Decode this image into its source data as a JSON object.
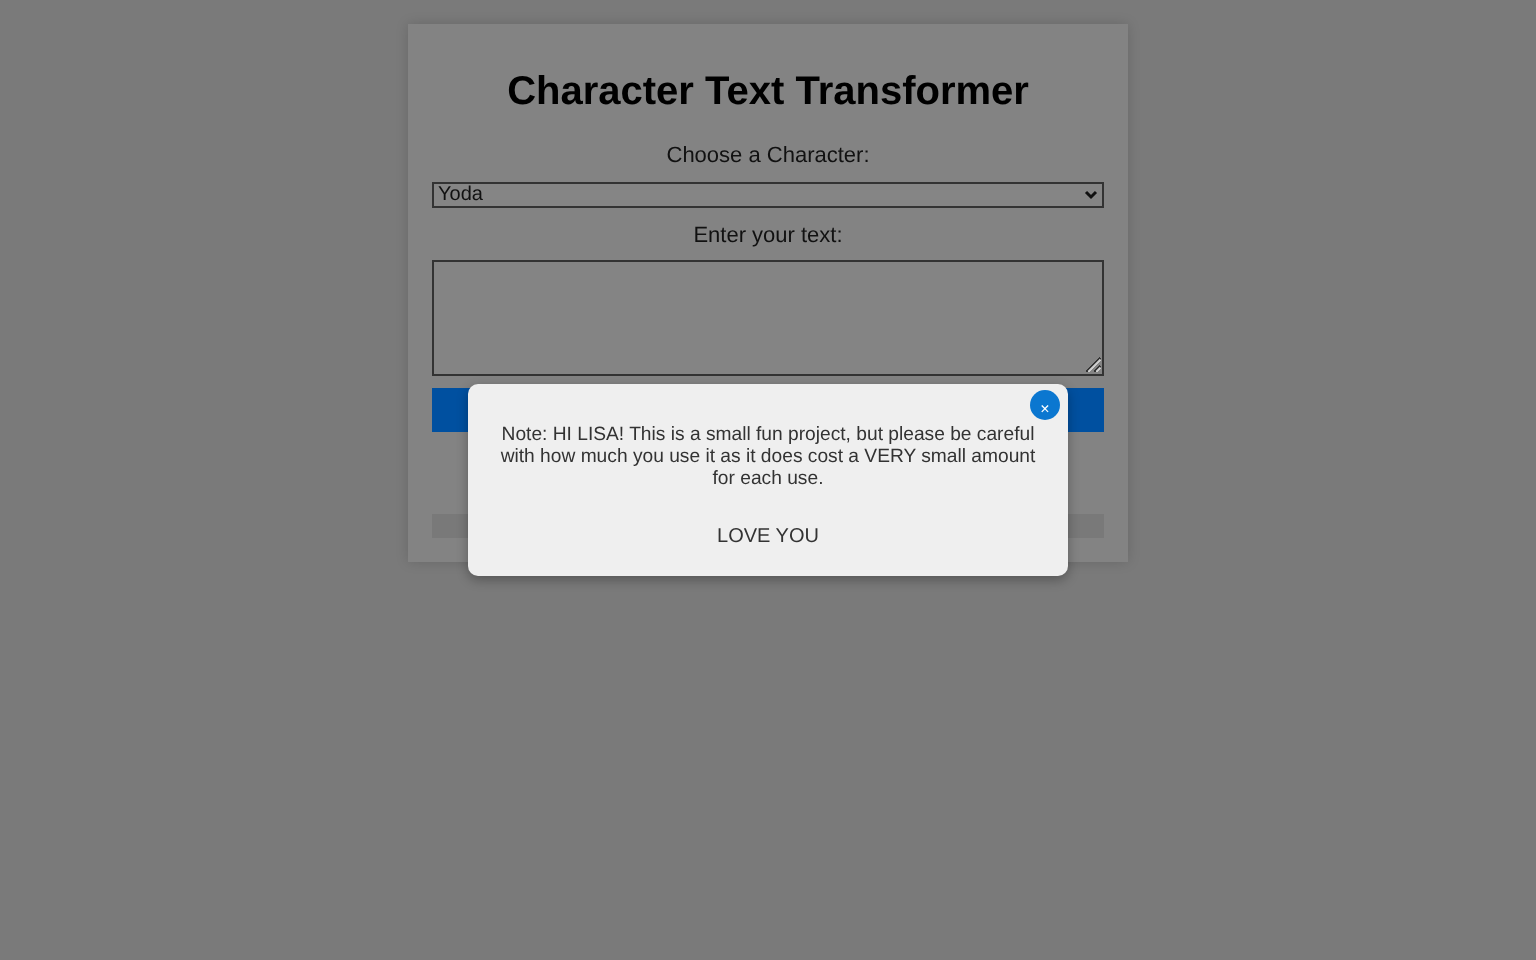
{
  "title": "Character Text Transformer",
  "character": {
    "label": "Choose a Character:",
    "value": "Yoda"
  },
  "text_input": {
    "label": "Enter your text:"
  },
  "modal": {
    "close": "×",
    "note": "Note: HI LISA! This is a small fun project, but please be careful with how much you use it as it does cost a VERY small amount for each use.",
    "signoff": "LOVE YOU"
  }
}
